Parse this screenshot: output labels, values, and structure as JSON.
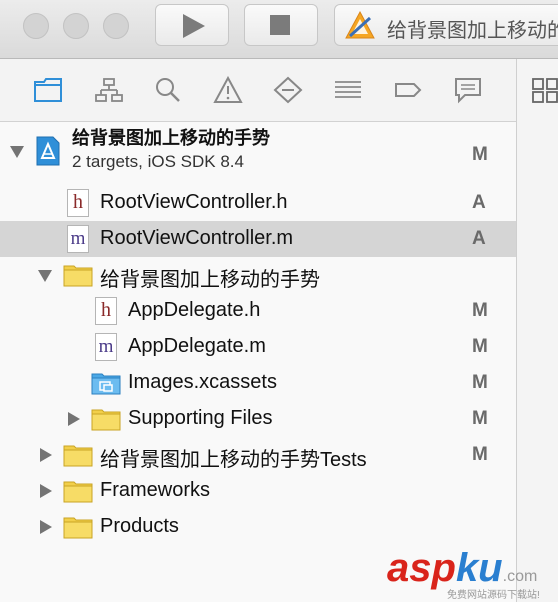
{
  "toolbar": {
    "scheme_title": "给背景图加上移动的手势"
  },
  "navigator": {
    "tabs": [
      "project-navigator",
      "symbol-navigator",
      "find-navigator",
      "issue-navigator",
      "test-navigator",
      "debug-navigator",
      "breakpoint-navigator",
      "report-navigator"
    ]
  },
  "project": {
    "name": "给背景图加上移动的手势",
    "subtitle": "2 targets, iOS SDK 8.4",
    "status": "M"
  },
  "files": [
    {
      "label": "RootViewController.h",
      "status": "A",
      "type": "h"
    },
    {
      "label": "RootViewController.m",
      "status": "A",
      "type": "m"
    },
    {
      "label": "给背景图加上移动的手势",
      "status": "",
      "type": "folder"
    },
    {
      "label": "AppDelegate.h",
      "status": "M",
      "type": "h"
    },
    {
      "label": "AppDelegate.m",
      "status": "M",
      "type": "m"
    },
    {
      "label": "Images.xcassets",
      "status": "M",
      "type": "assets"
    },
    {
      "label": "Supporting Files",
      "status": "M",
      "type": "folder"
    },
    {
      "label": "给背景图加上移动的手势Tests",
      "status": "M",
      "type": "folder"
    },
    {
      "label": "Frameworks",
      "status": "",
      "type": "folder"
    },
    {
      "label": "Products",
      "status": "",
      "type": "folder"
    }
  ],
  "file_type_letters": {
    "h": "h",
    "m": "m"
  },
  "watermark": {
    "brand_a": "asp",
    "brand_b": "ku",
    "brand_c": ".com",
    "tagline": "免费网站源码下载站!"
  },
  "colors": {
    "accent": "#2f8fd8",
    "selection": "#d5d5d5",
    "folder": "#f2cf4a",
    "h_letter": "#8a2a2a",
    "m_letter": "#4a3a88",
    "watermark_red": "#d9241b",
    "watermark_blue": "#2a7fd0"
  }
}
